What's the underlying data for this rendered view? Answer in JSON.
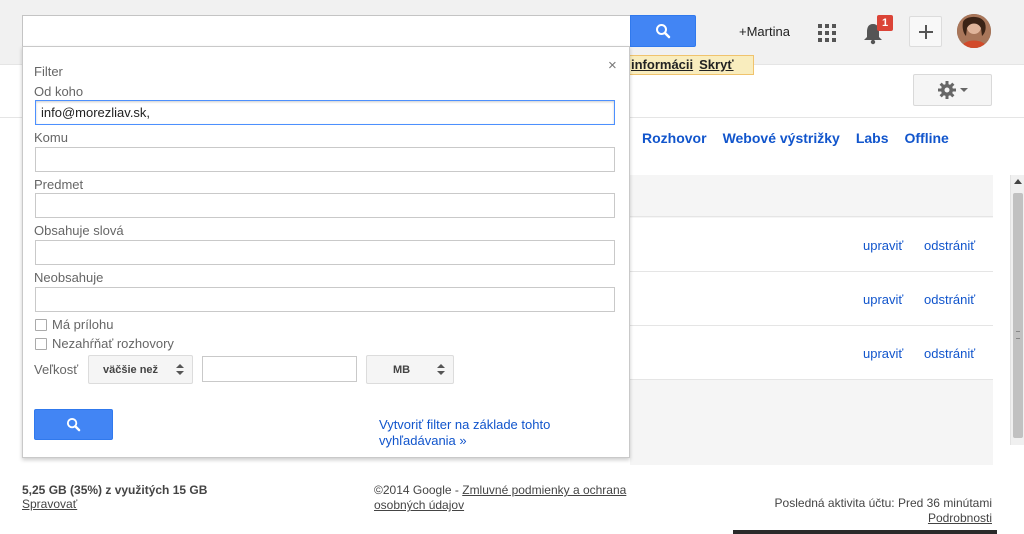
{
  "header": {
    "user_link": "+Martina",
    "notification_count": "1"
  },
  "notify_strip": {
    "info_link": "informácii",
    "hide_link": "Skryť"
  },
  "settings_tabs": [
    {
      "label": "Rozhovor"
    },
    {
      "label": "Webové výstrižky"
    },
    {
      "label": "Labs"
    },
    {
      "label": "Offline"
    }
  ],
  "filters_table": {
    "rows": [
      {
        "edit": "upraviť",
        "delete": "odstrániť"
      },
      {
        "edit": "upraviť",
        "delete": "odstrániť"
      },
      {
        "edit": "upraviť",
        "delete": "odstrániť"
      }
    ]
  },
  "filter_panel": {
    "title": "Filter",
    "close": "×",
    "from_label": "Od koho",
    "from_value": "info@morezliav.sk,",
    "to_label": "Komu",
    "subject_label": "Predmet",
    "has_words_label": "Obsahuje slová",
    "no_words_label": "Neobsahuje",
    "has_attachment_label": "Má prílohu",
    "no_chats_label": "Nezahŕňať rozhovory",
    "size_label": "Veľkosť",
    "size_op": "väčšie než",
    "size_unit": "MB",
    "create_filter_link": "Vytvoriť filter na základe tohto vyhľadávania »"
  },
  "footer": {
    "storage": "5,25 GB (35%) z využitých 15 GB",
    "manage": "Spravovať",
    "copyright": "©2014 Google - ",
    "terms": "Zmluvné podmienky a ochrana osobných údajov",
    "last_activity": "Posledná aktivita účtu: Pred 36 minútami",
    "details": "Podrobnosti"
  },
  "colors": {
    "accent_blue": "#4285f4",
    "link_blue": "#1155cc",
    "badge_red": "#db4437"
  }
}
